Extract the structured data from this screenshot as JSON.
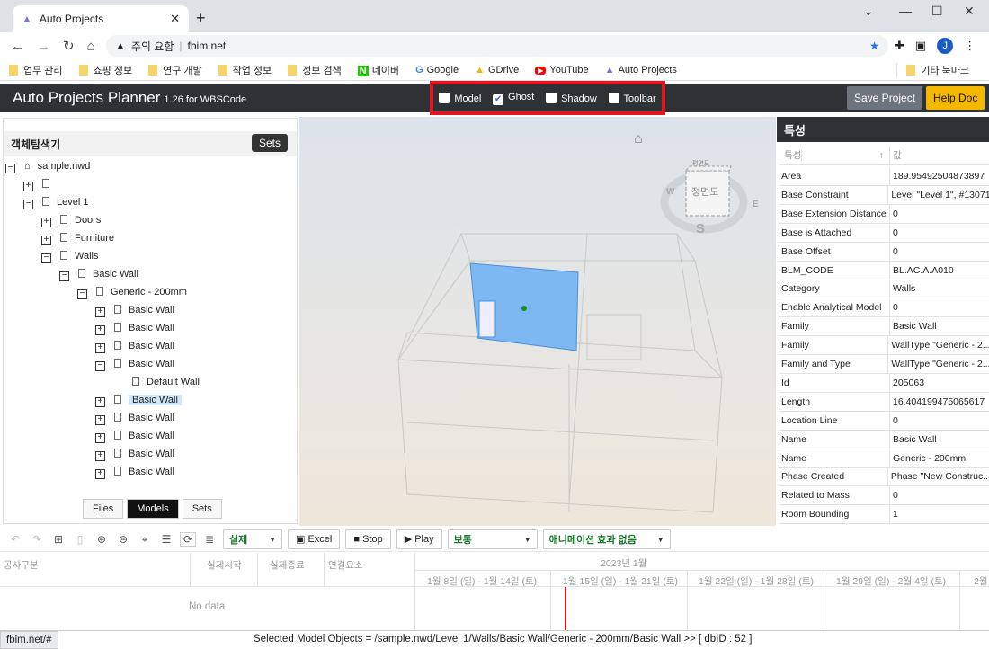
{
  "browser": {
    "tab_title": "Auto Projects",
    "warning": "주의 요함",
    "url": "fbim.net",
    "profile_initial": "J",
    "bookmarks": [
      "업무 관리",
      "쇼핑 정보",
      "연구 개발",
      "작업 정보",
      "정보 검색",
      "네이버",
      "Google",
      "GDrive",
      "YouTube",
      "Auto Projects"
    ],
    "other_bookmarks": "기타 북마크"
  },
  "app": {
    "title": "Auto Projects Planner",
    "version": "1.26 for WBSCode",
    "toggles": [
      {
        "label": "Model",
        "checked": false
      },
      {
        "label": "Ghost",
        "checked": true
      },
      {
        "label": "Shadow",
        "checked": false
      },
      {
        "label": "Toolbar",
        "checked": false
      }
    ],
    "save_label": "Save Project",
    "help_label": "Help Doc",
    "accent_color": "#f5b800",
    "highlight_color": "#e4151f"
  },
  "explorer": {
    "title": "객체탐색기",
    "sets_button": "Sets",
    "tree": [
      {
        "label": "sample.nwd",
        "level": 0,
        "toggle": "-",
        "icon": "home"
      },
      {
        "label": "",
        "level": 1,
        "toggle": "+"
      },
      {
        "label": "Level 1",
        "level": 1,
        "toggle": "-"
      },
      {
        "label": "Doors",
        "level": 2,
        "toggle": "+"
      },
      {
        "label": "Furniture",
        "level": 2,
        "toggle": "+"
      },
      {
        "label": "Walls",
        "level": 2,
        "toggle": "-"
      },
      {
        "label": "Basic Wall",
        "level": 3,
        "toggle": "-"
      },
      {
        "label": "Generic - 200mm",
        "level": 4,
        "toggle": "-"
      },
      {
        "label": "Basic Wall",
        "level": 5,
        "toggle": "+"
      },
      {
        "label": "Basic Wall",
        "level": 5,
        "toggle": "+"
      },
      {
        "label": "Basic Wall",
        "level": 5,
        "toggle": "+"
      },
      {
        "label": "Basic Wall",
        "level": 5,
        "toggle": "-"
      },
      {
        "label": "Default Wall",
        "level": 6,
        "toggle": ""
      },
      {
        "label": "Basic Wall",
        "level": 5,
        "toggle": "+",
        "selected": true
      },
      {
        "label": "Basic Wall",
        "level": 5,
        "toggle": "+"
      },
      {
        "label": "Basic Wall",
        "level": 5,
        "toggle": "+"
      },
      {
        "label": "Basic Wall",
        "level": 5,
        "toggle": "+"
      },
      {
        "label": "Basic Wall",
        "level": 5,
        "toggle": "+"
      }
    ],
    "tabs": [
      "Files",
      "Models",
      "Sets"
    ],
    "active_tab": "Models"
  },
  "viewcube": {
    "top": "평면도",
    "front": "정면도",
    "compass": [
      "W",
      "E",
      "S"
    ]
  },
  "properties": {
    "title": "특성",
    "col_name": "특성",
    "col_value": "값",
    "rows": [
      [
        "Area",
        "189.95492504873897"
      ],
      [
        "Base Constraint",
        "Level \"Level 1\", #13071"
      ],
      [
        "Base Extension Distance",
        "0"
      ],
      [
        "Base is Attached",
        "0"
      ],
      [
        "Base Offset",
        "0"
      ],
      [
        "BLM_CODE",
        "BL.AC.A.A010"
      ],
      [
        "Category",
        "Walls"
      ],
      [
        "Enable Analytical Model",
        "0"
      ],
      [
        "Family",
        "Basic Wall"
      ],
      [
        "Family",
        "WallType \"Generic - 2..."
      ],
      [
        "Family and Type",
        "WallType \"Generic - 2..."
      ],
      [
        "Id",
        "205063"
      ],
      [
        "Length",
        "16.404199475065617"
      ],
      [
        "Location Line",
        "0"
      ],
      [
        "Name",
        "Basic Wall"
      ],
      [
        "Name",
        "Generic - 200mm"
      ],
      [
        "Phase Created",
        "Phase \"New Construc..."
      ],
      [
        "Related to Mass",
        "0"
      ],
      [
        "Room Bounding",
        "1"
      ]
    ]
  },
  "toolbar": {
    "mode": "실제",
    "excel": "Excel",
    "stop": "Stop",
    "play": "Play",
    "speed": "보통",
    "animation": "애니메이션 효과 없음"
  },
  "gantt": {
    "columns": [
      "공사구분",
      "실제시작",
      "실제종료",
      "연결요소"
    ],
    "month": "2023년 1월",
    "weeks": [
      "1월 8일 (일) - 1월 14일 (토)",
      "1월 15일 (일) - 1월 21일 (토)",
      "1월 22일 (일) - 1월 28일 (토)",
      "1월 29일 (일) - 2월 4일 (토)",
      "2월"
    ],
    "empty": "No data"
  },
  "status": {
    "link": "fbim.net/#",
    "selected": "Selected Model Objects = /sample.nwd/Level 1/Walls/Basic Wall/Generic - 200mm/Basic Wall >> [ dbID : 52 ]"
  }
}
